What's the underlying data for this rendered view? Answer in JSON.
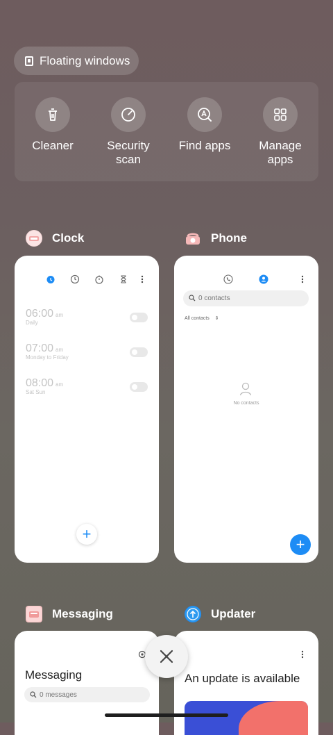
{
  "floating": {
    "label": "Floating windows"
  },
  "tools": [
    {
      "label": "Cleaner",
      "icon": "trash-icon"
    },
    {
      "label": "Security scan",
      "icon": "gauge-icon"
    },
    {
      "label": "Find apps",
      "icon": "find-apps-icon"
    },
    {
      "label": "Manage apps",
      "icon": "grid-icon"
    }
  ],
  "apps": {
    "clock": {
      "name": "Clock",
      "alarms": [
        {
          "time": "06:00",
          "ampm": "am",
          "repeat": "Daily"
        },
        {
          "time": "07:00",
          "ampm": "am",
          "repeat": "Monday to Friday"
        },
        {
          "time": "08:00",
          "ampm": "am",
          "repeat": "Sat Sun"
        }
      ],
      "fab": "+"
    },
    "phone": {
      "name": "Phone",
      "search_placeholder": "0 contacts",
      "filter": "All contacts",
      "empty": "No contacts",
      "fab": "+"
    },
    "messaging": {
      "name": "Messaging",
      "title": "Messaging",
      "search_placeholder": "0 messages"
    },
    "updater": {
      "name": "Updater",
      "title": "An update is available"
    }
  },
  "colors": {
    "accent": "#1d8cf5"
  }
}
